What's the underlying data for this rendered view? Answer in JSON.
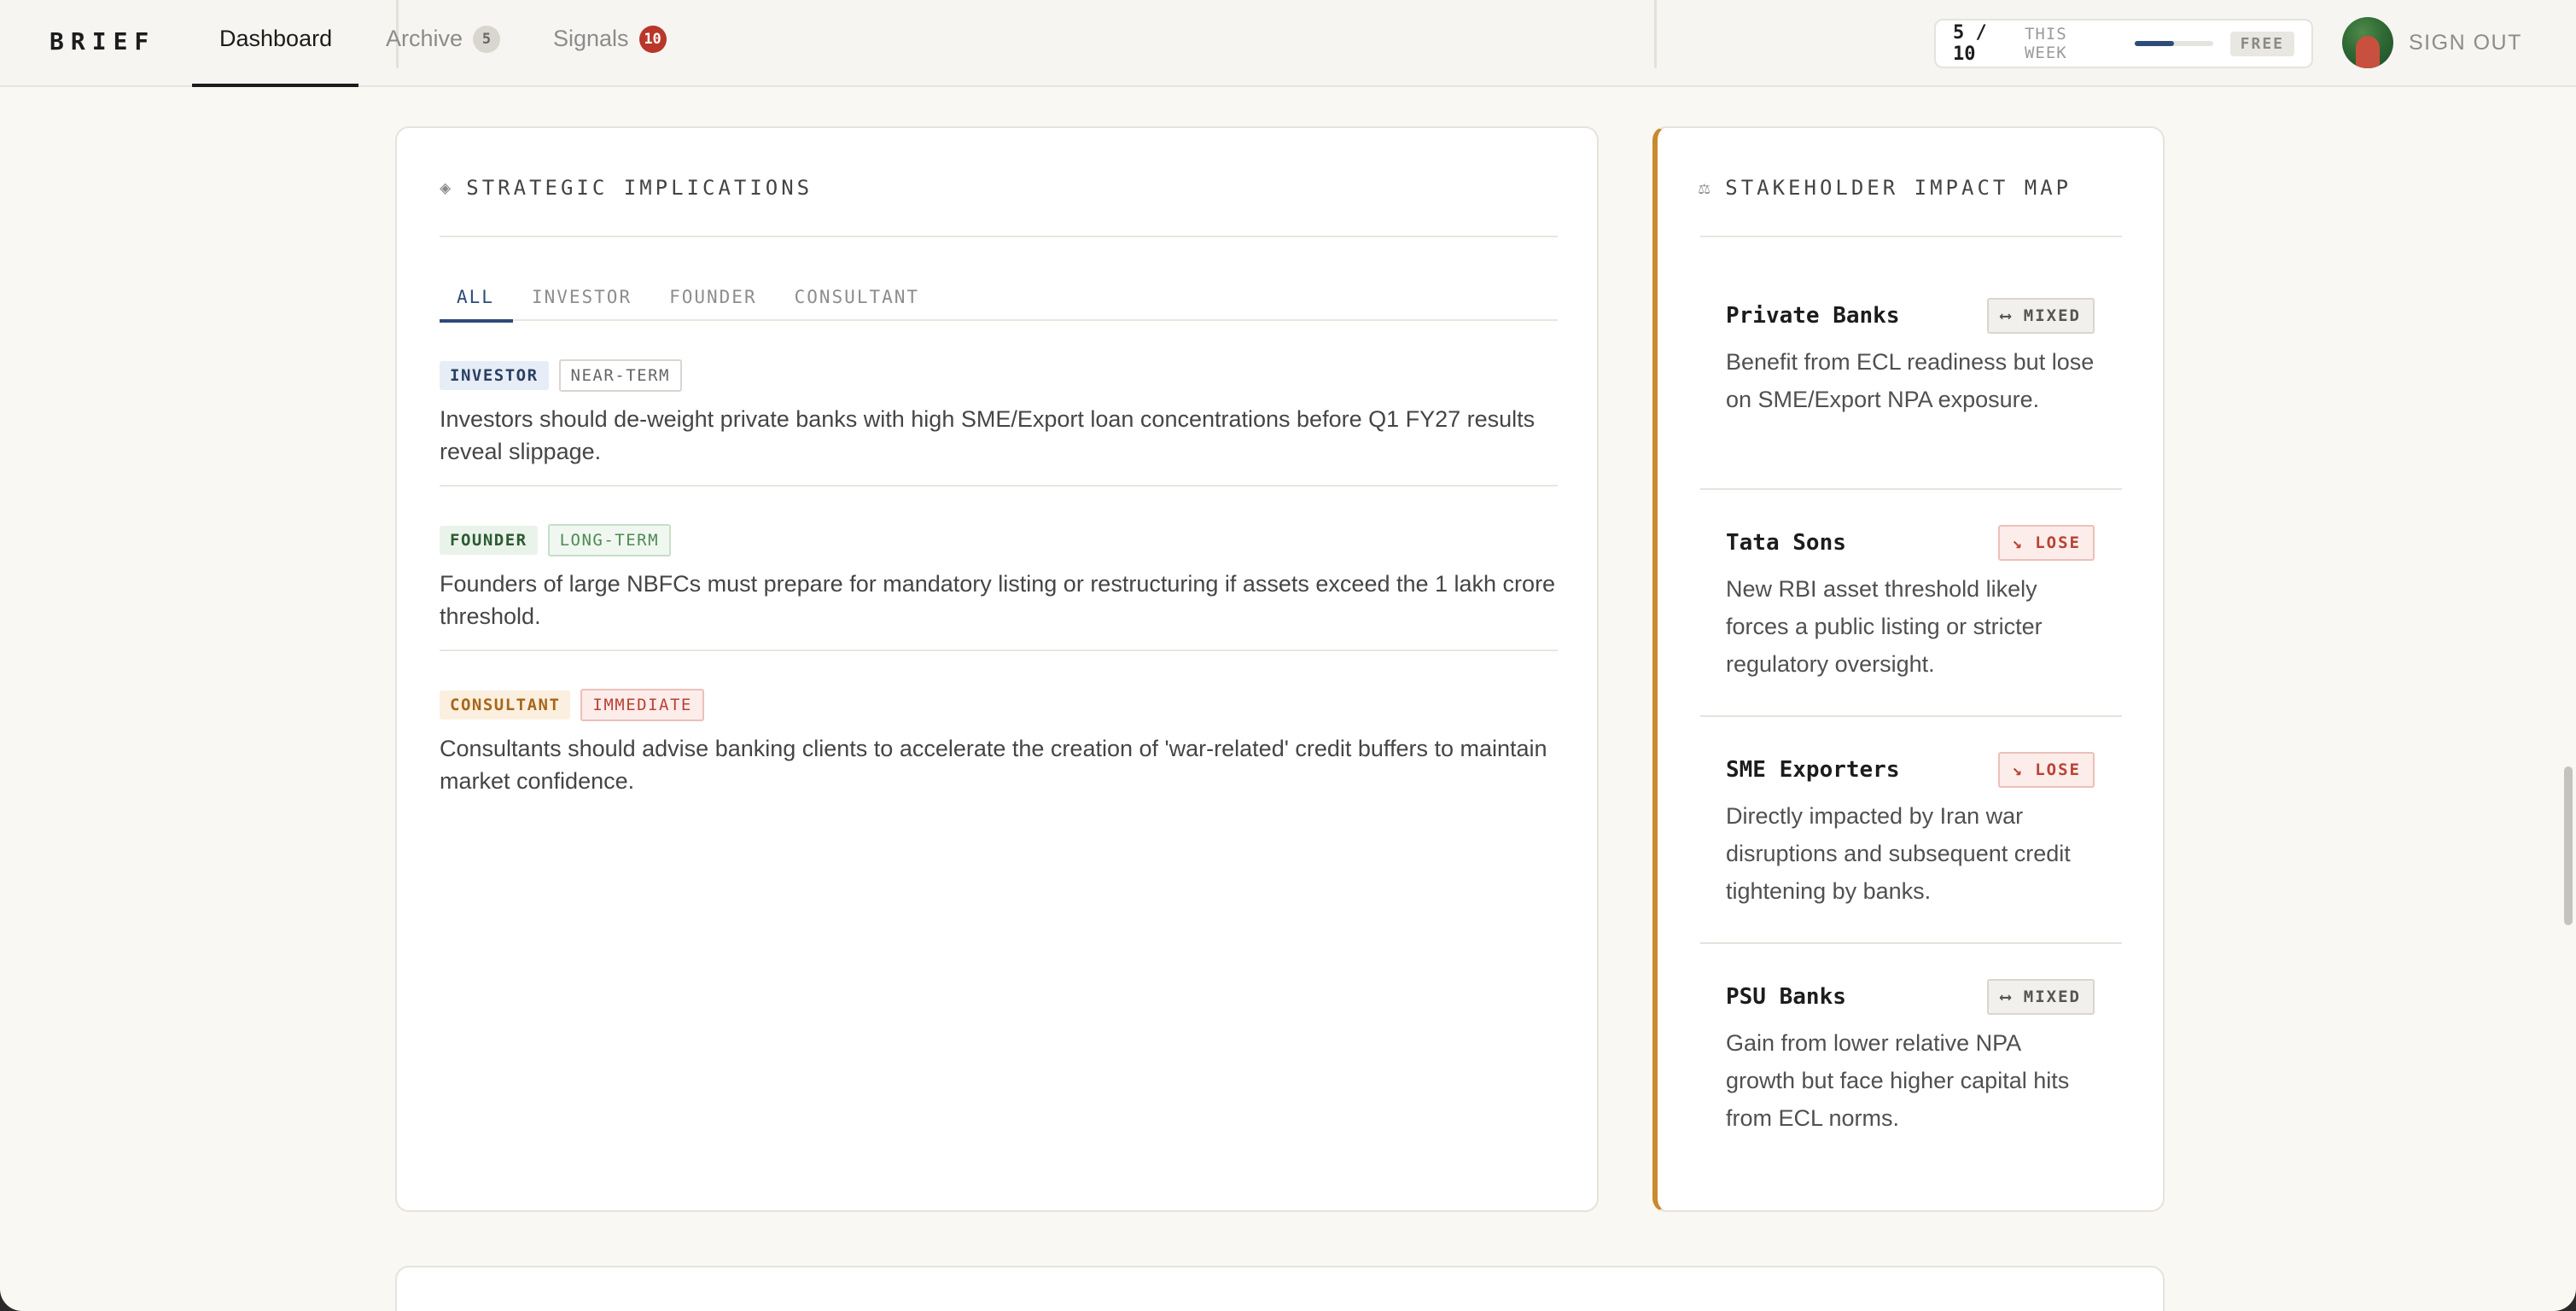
{
  "header": {
    "brand": "BRIEF",
    "nav": [
      {
        "label": "Dashboard",
        "active": true
      },
      {
        "label": "Archive",
        "badge": "5"
      },
      {
        "label": "Signals",
        "badge": "10"
      }
    ],
    "quota": {
      "count": "5 / 10",
      "period": "THIS WEEK",
      "progress": 0.5,
      "plan": "FREE"
    },
    "sign_out": "SIGN OUT"
  },
  "implications": {
    "icon": "diamond-icon",
    "title": "STRATEGIC IMPLICATIONS",
    "tabs": [
      "ALL",
      "INVESTOR",
      "FOUNDER",
      "CONSULTANT"
    ],
    "active_tab": "ALL",
    "items": [
      {
        "role": "INVESTOR",
        "term": "NEAR-TERM",
        "text": "Investors should de-weight private banks with high SME/Export loan concentrations before Q1 FY27 results reveal slippage."
      },
      {
        "role": "FOUNDER",
        "term": "LONG-TERM",
        "text": "Founders of large NBFCs must prepare for mandatory listing or restructuring if assets exceed the 1 lakh crore threshold."
      },
      {
        "role": "CONSULTANT",
        "term": "IMMEDIATE",
        "text": "Consultants should advise banking clients to accelerate the creation of 'war-related' credit buffers to maintain market confidence."
      }
    ]
  },
  "stakeholders": {
    "icon": "scale-icon",
    "title": "STAKEHOLDER IMPACT MAP",
    "items": [
      {
        "name": "Private Banks",
        "badge": "⟷ MIXED",
        "impact": "mixed",
        "text": "Benefit from ECL readiness but lose on SME/Export NPA exposure."
      },
      {
        "name": "Tata Sons",
        "badge": "↘ LOSE",
        "impact": "lose",
        "text": "New RBI asset threshold likely forces a public listing or stricter regulatory oversight."
      },
      {
        "name": "SME Exporters",
        "badge": "↘ LOSE",
        "impact": "lose",
        "text": "Directly impacted by Iran war disruptions and subsequent credit tightening by banks."
      },
      {
        "name": "PSU Banks",
        "badge": "⟷ MIXED",
        "impact": "mixed",
        "text": "Gain from lower relative NPA growth but face higher capital hits from ECL norms."
      }
    ]
  },
  "colors": {
    "accent": "#2e4b7a",
    "stakeholder_border": "#c98a2e",
    "signals_badge": "#b8362a",
    "lose": "#b84334"
  }
}
